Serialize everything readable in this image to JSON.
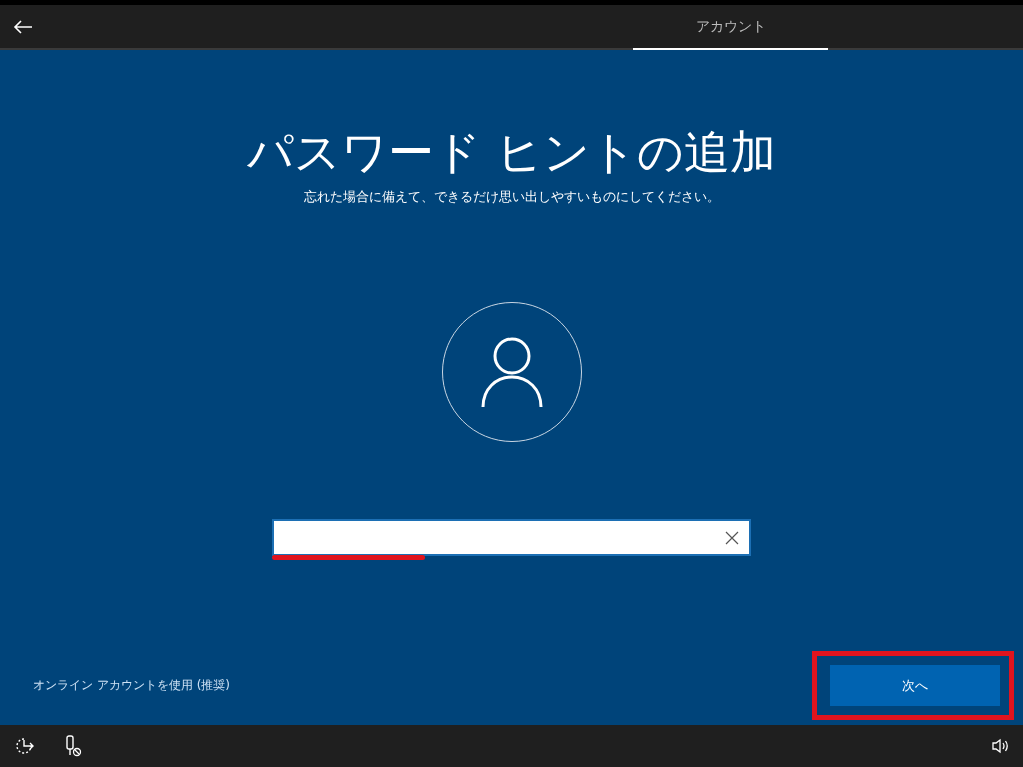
{
  "header": {
    "tabs": [
      {
        "label": "アカウント",
        "selected": true
      }
    ]
  },
  "title": "パスワード ヒントの追加",
  "subtitle": "忘れた場合に備えて、できるだけ思い出しやすいものにしてください。",
  "footer": {
    "link": "オンライン アカウントを使用 (推奨)",
    "next_button": "次へ"
  }
}
